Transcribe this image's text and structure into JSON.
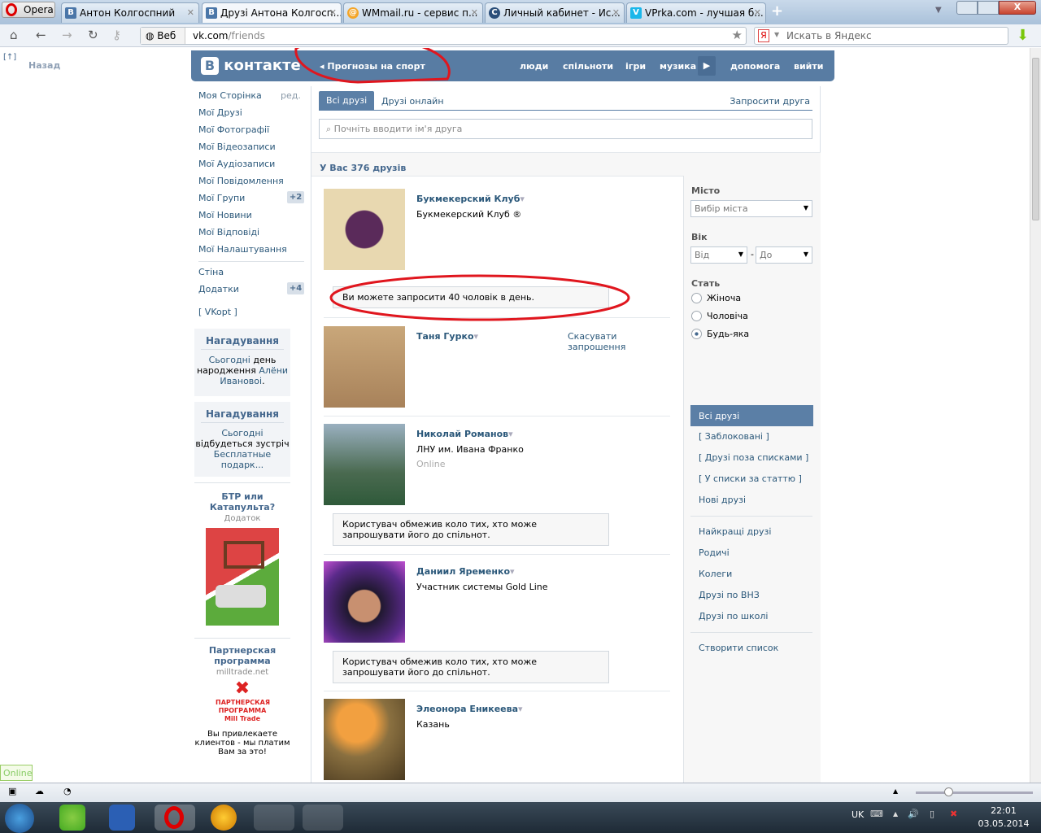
{
  "browser": {
    "opera_menu": "Opera",
    "tabs": [
      {
        "title": "Антон Колгоспний",
        "icon": "vk-icon"
      },
      {
        "title": "Друзі Антона Колгосп...",
        "icon": "vk-icon",
        "active": true
      },
      {
        "title": "WMmail.ru - сервис п...",
        "icon": "wmmail-icon"
      },
      {
        "title": "Личный кабинет - Ис...",
        "icon": "cabinet-icon"
      },
      {
        "title": "VPrka.com - лучшая б...",
        "icon": "vprka-icon"
      }
    ],
    "web_label": "Веб",
    "url_domain": "vk.com",
    "url_path": "/friends",
    "search_placeholder": "Искать в Яндекс",
    "back_label": "Назад"
  },
  "vk": {
    "logo": "контакте",
    "app_link": "Прогнозы на спорт",
    "nav": [
      "люди",
      "спільноти",
      "ігри",
      "музика",
      "допомога",
      "вийти"
    ],
    "menu": [
      {
        "label": "Моя Сторінка",
        "extra": "ред."
      },
      {
        "label": "Мої Друзі"
      },
      {
        "label": "Мої Фотографії"
      },
      {
        "label": "Мої Відеозаписи"
      },
      {
        "label": "Мої Аудіозаписи"
      },
      {
        "label": "Мої Повідомлення"
      },
      {
        "label": "Мої Групи",
        "badge": "+2"
      },
      {
        "label": "Мої Новини"
      },
      {
        "label": "Мої Відповіді"
      },
      {
        "label": "Мої Налаштування"
      },
      {
        "label": "Стіна"
      },
      {
        "label": "Додатки",
        "badge": "+4"
      },
      {
        "label": "[ VKopt ]"
      }
    ],
    "reminders": [
      {
        "title": "Нагадування",
        "line1": "Сьогодні",
        "line1b": " день",
        "line2": "народження ",
        "link": "Алёни",
        "line3": "Ивановоі",
        "dot": "."
      },
      {
        "title": "Нагадування",
        "line1": "Сьогодні",
        "line2": "відбудеться зустріч",
        "link": "Бесплатные подарк..."
      }
    ],
    "ads": [
      {
        "title": "БТР или Катапульта?",
        "sub": "Додаток"
      },
      {
        "title": "Партнерская программа",
        "sub": "milltrade.net",
        "logo_text": "ПАРТНЕРСКАЯ ПРОГРАММА Mill Trade",
        "text": "Вы привлекаете клиентов - мы платим Вам за это!"
      }
    ],
    "online_badge": "Online"
  },
  "friends": {
    "tabs": [
      "Всі друзі",
      "Друзі онлайн"
    ],
    "invite_link": "Запросити друга",
    "search_placeholder": "Почніть вводити ім'я друга",
    "count_label": "У Вас 376 друзів",
    "list": [
      {
        "name": "Букмекерский Клуб",
        "sub": "Букмекерский Клуб ®",
        "notice": "Ви можете запросити 40 чоловік в день."
      },
      {
        "name": "Таня Гурко",
        "action": "Скасувати запрошення"
      },
      {
        "name": "Николай Романов",
        "sub": "ЛНУ им. Ивана Франко",
        "status": "Online",
        "notice": "Користувач обмежив коло тих, хто може запрошувати його до спільнот."
      },
      {
        "name": "Даниил Яременко",
        "sub": "Участник системы Gold Line",
        "notice": "Користувач обмежив коло тих, хто може запрошувати його до спільнот."
      },
      {
        "name": "Элеонора Еникеева",
        "sub": "Казань"
      }
    ],
    "filters": {
      "city_label": "Місто",
      "city_value": "Вибір міста",
      "age_label": "Вік",
      "age_from": "Від",
      "age_to": "До",
      "age_sep": "-",
      "sex_label": "Стать",
      "sex_options": [
        "Жіноча",
        "Чоловіча",
        "Будь-яка"
      ],
      "sex_selected": 2,
      "lists": [
        "Всі друзі",
        "[ Заблоковані ]",
        "[ Друзі поза списками ]",
        "[ У списки за статтю ]",
        "Нові друзі",
        "Найкращі друзі",
        "Родичі",
        "Колеги",
        "Друзі по ВНЗ",
        "Друзі по школі",
        "Створити список"
      ]
    }
  },
  "taskbar": {
    "lang": "UK",
    "time": "22:01",
    "date": "03.05.2014"
  },
  "colors": {
    "vk_blue": "#587ca3",
    "link": "#2b587a",
    "annotation_red": "#e0161e"
  }
}
